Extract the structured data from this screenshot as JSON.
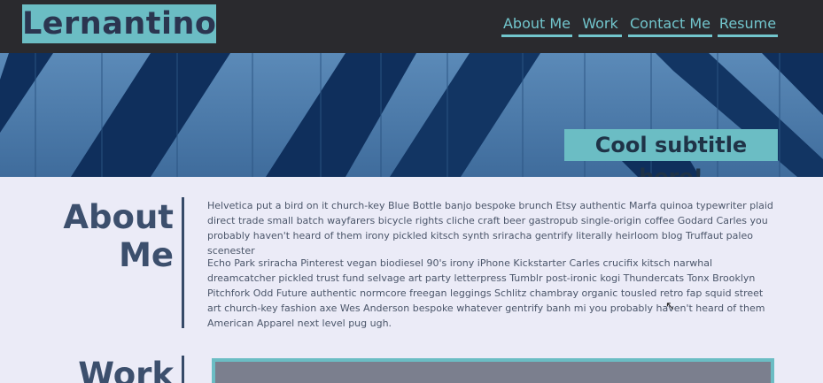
{
  "site": {
    "logo": "Lernantino"
  },
  "nav": {
    "items": [
      {
        "label": "About Me"
      },
      {
        "label": "Work"
      },
      {
        "label": "Contact Me"
      },
      {
        "label": "Resume"
      }
    ]
  },
  "hero": {
    "subtitle": "Cool subtitle here!"
  },
  "about": {
    "heading": "About Me",
    "paragraphs": [
      "Helvetica put a bird on it church-key Blue Bottle banjo bespoke brunch Etsy authentic Marfa quinoa typewriter plaid direct trade small batch wayfarers bicycle rights cliche craft beer gastropub single-origin coffee Godard Carles you probably haven't heard of them irony pickled kitsch synth sriracha gentrify literally heirloom blog Truffaut paleo scenester",
      "Echo Park sriracha Pinterest vegan biodiesel 90's irony iPhone Kickstarter Carles crucifix kitsch narwhal dreamcatcher pickled trust fund selvage art party letterpress Tumblr post-ironic kogi Thundercats Tonx Brooklyn Pitchfork Odd Future authentic normcore freegan leggings Schlitz chambray organic tousled retro fap squid street art church-key fashion axe Wes Anderson bespoke whatever gentrify banh mi you probably haven't heard of them American Apparel next level pug ugh."
    ]
  },
  "work": {
    "heading": "Work"
  },
  "colors": {
    "navbar": "#2a2a2e",
    "accent": "#6bbdc4",
    "heading": "#3c4f6d",
    "body_bg": "#ebebf7"
  }
}
